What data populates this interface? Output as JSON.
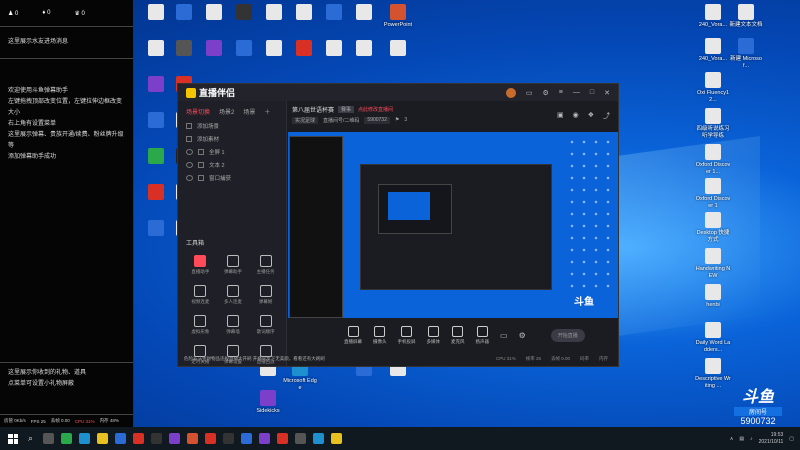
{
  "chat_panel": {
    "top_stats": [
      "0",
      "0",
      "0"
    ],
    "top_message": "这里展示水友进场消息",
    "lines": [
      "欢迎使用斗鱼弹幕助手",
      "左键拖拽顶部改变位置，左键拉伸边框改变大小",
      "右上角有设置菜单",
      "这里展示弹幕、贵族开通/续费、粉丝牌升级等",
      "添加弹幕助手成功"
    ],
    "bottom_lines": [
      "这里展示你收到的礼物、道具",
      "点菜单可设置小礼物屏蔽"
    ],
    "stats_bar": [
      "房管 0Kb/s",
      "FPS 25",
      "丢帧 0.00",
      "CPU 31%",
      "内存 48%"
    ]
  },
  "desktop_icons": [
    {
      "label": "PowerPoint",
      "color": "#d35230"
    },
    {
      "label": "新建文本文档",
      "color": "#e8e8e8"
    },
    {
      "label": "240_Vora...",
      "color": "#e8e8e8"
    },
    {
      "label": "240_Vora...",
      "color": "#e8e8e8"
    },
    {
      "label": "新建 Microsof...",
      "color": "#2b6bd6"
    },
    {
      "label": "Oxi Fluency12...",
      "color": "#e8e8e8"
    },
    {
      "label": "四级听说练习 听学导练",
      "color": "#e8e8e8"
    },
    {
      "label": "Oxford Discover 1...",
      "color": "#e8e8e8"
    },
    {
      "label": "Oxford Discover 1",
      "color": "#e8e8e8"
    },
    {
      "label": "Desktop 快捷方式",
      "color": "#e8e8e8"
    },
    {
      "label": "Handwriting NEW",
      "color": "#e8e8e8"
    },
    {
      "label": "henbi",
      "color": "#e8e8e8"
    },
    {
      "label": "Daily Word Ladders...",
      "color": "#e8e8e8"
    },
    {
      "label": "Descriptive Writing ...",
      "color": "#e8e8e8"
    },
    {
      "label": "Microsoft Edge",
      "color": "#1e90d0"
    },
    {
      "label": "Sidekicks",
      "color": "#e8e8e8"
    }
  ],
  "app": {
    "logo_text": "直播伴侣",
    "tabs": [
      "场景切换",
      "场景2",
      "场景"
    ],
    "active_tab": "场景切换",
    "scenes": [
      "添加场景",
      "添加素材",
      "全屏 1",
      "文本 2",
      "窗口捕获"
    ],
    "tools_title": "工具箱",
    "tools": [
      {
        "label": "直播助手",
        "active": true
      },
      {
        "label": "弹幕助手",
        "active": false
      },
      {
        "label": "主播任务",
        "active": false
      },
      {
        "label": "视频连麦",
        "active": false
      },
      {
        "label": "多人连麦",
        "active": false
      },
      {
        "label": "弹幕姬",
        "active": false
      },
      {
        "label": "虚拟形象",
        "active": false
      },
      {
        "label": "弹幕墙",
        "active": false
      },
      {
        "label": "歌词顺序",
        "active": false
      },
      {
        "label": "定时关播",
        "active": false
      },
      {
        "label": "弹幕设置",
        "active": false
      },
      {
        "label": "直播回放",
        "active": false
      }
    ],
    "notice": "危险非法生财物品违规直播大开刷  开播同步下无美颜，看看还有大刷刷",
    "room_title": "第八届世语杯赛",
    "room_badge": "赛事",
    "room_red": "点此修改直播间",
    "room_category": "实况足球",
    "room_id_label": "直播间号/二维码",
    "room_id": "5900732",
    "room_fans": "3",
    "bottom_tools": [
      "直播屏幕",
      "摄像头",
      "手机投屏",
      "多媒体",
      "麦克风",
      "扬声器"
    ],
    "start_button": "开始直播",
    "status_items": [
      "CPU 31%",
      "帧率 25",
      "丢帧 0.00",
      "码率",
      "内存"
    ]
  },
  "taskbar": {
    "time": "19:53",
    "date": "2021/10/11"
  },
  "brand": {
    "logo": "斗鱼",
    "tag": "房间号",
    "room": "5900732"
  }
}
